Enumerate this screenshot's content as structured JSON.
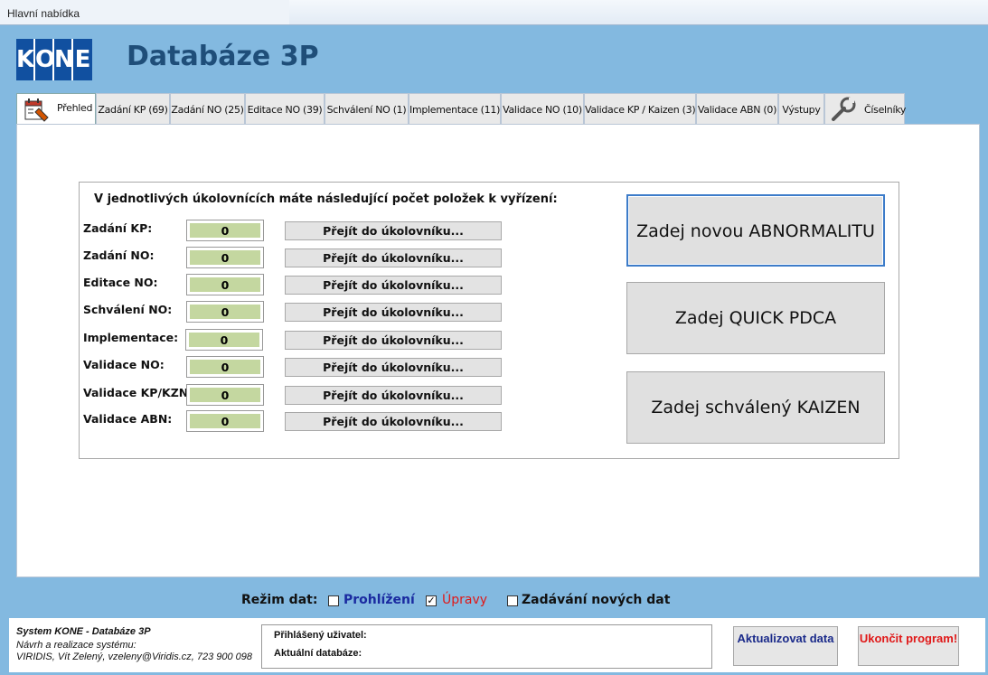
{
  "window": {
    "title": "Hlavní nabídka"
  },
  "logo": {
    "letters": [
      "K",
      "O",
      "N",
      "E"
    ],
    "brand_color": "#1150a0"
  },
  "header": {
    "title": "Databáze 3P"
  },
  "tabs": [
    {
      "label": "Přehled",
      "icon": "calendar-report-icon",
      "active": true
    },
    {
      "label": "Zadání KP (69)"
    },
    {
      "label": "Zadání NO (25)"
    },
    {
      "label": "Editace NO (39)"
    },
    {
      "label": "Schválení NO (1)"
    },
    {
      "label": "Implementace (11)"
    },
    {
      "label": "Validace NO (10)"
    },
    {
      "label": "Validace KP / Kaizen (3)"
    },
    {
      "label": "Validace ABN (0)"
    },
    {
      "label": "Výstupy"
    },
    {
      "label": "Číselníky",
      "icon": "wrench-icon"
    }
  ],
  "overview": {
    "heading": "V jednotlivých úkolovnících máte následující počet položek k vyřízení:",
    "rows": [
      {
        "label": "Zadání KP:",
        "count": "0",
        "button": "Přejít do úkolovníku..."
      },
      {
        "label": "Zadání NO:",
        "count": "0",
        "button": "Přejít do úkolovníku..."
      },
      {
        "label": "Editace NO:",
        "count": "0",
        "button": "Přejít do úkolovníku..."
      },
      {
        "label": "Schválení NO:",
        "count": "0",
        "button": "Přejít do úkolovníku..."
      },
      {
        "label": "Implementace:",
        "count": "0",
        "button": "Přejít do úkolovníku..."
      },
      {
        "label": "Validace NO:",
        "count": "0",
        "button": "Přejít do úkolovníku..."
      },
      {
        "label": "Validace KP/KZN:",
        "count": "0",
        "button": "Přejít do úkolovníku..."
      },
      {
        "label": "Validace ABN:",
        "count": "0",
        "button": "Přejít do úkolovníku..."
      }
    ],
    "actions": [
      {
        "label": "Zadej novou ABNORMALITU"
      },
      {
        "label": "Zadej QUICK PDCA"
      },
      {
        "label": "Zadej schválený KAIZEN"
      }
    ]
  },
  "mode": {
    "label": "Režim dat:",
    "options": [
      {
        "label": "Prohlížení",
        "checked": false,
        "color": "#1a2aa0"
      },
      {
        "label": "Úpravy",
        "checked": true,
        "color": "#e01818"
      },
      {
        "label": "Zadávání nových dat",
        "checked": false,
        "color": "#111111"
      }
    ]
  },
  "footer": {
    "system": "System  KONE - Databáze 3P",
    "design": "Návrh a realizace systému:",
    "author": "VIRIDIS, Vít Zelený, vzeleny@Viridis.cz, 723 900 098",
    "user_label": "Přihlášený uživatel:",
    "db_label": "Aktuální databáze:",
    "refresh_button": "Aktualizovat data",
    "exit_button": "Ukončit program!",
    "refresh_color": "#1a2a8a",
    "exit_color": "#e01818"
  }
}
